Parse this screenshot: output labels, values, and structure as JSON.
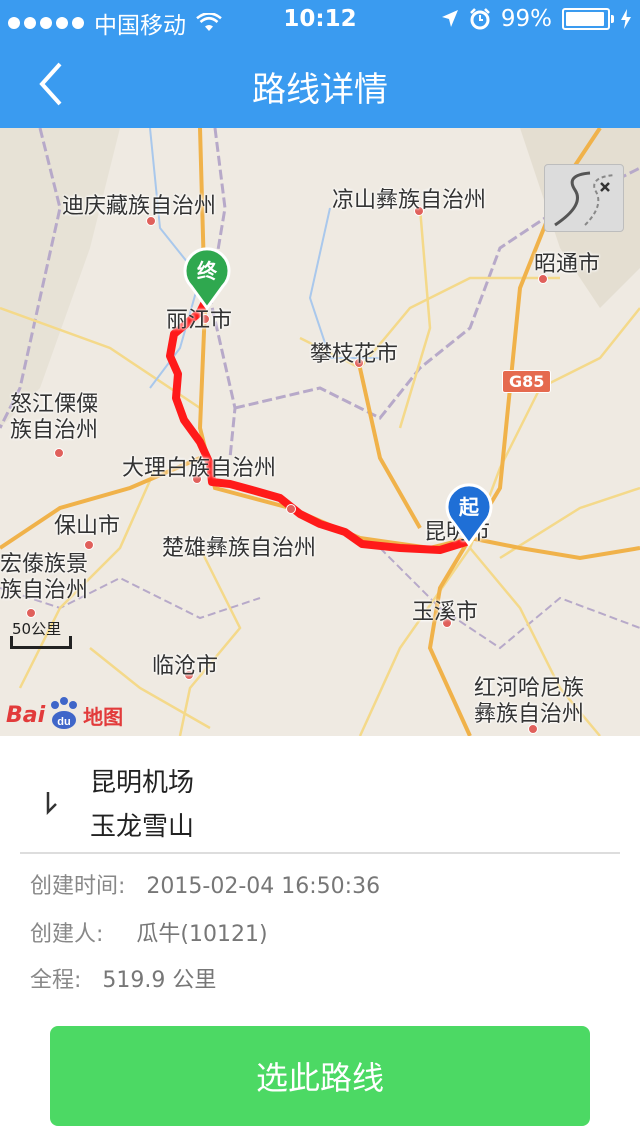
{
  "status": {
    "carrier": "中国移动",
    "time": "10:12",
    "battery": "99%",
    "battery_level": 0.99
  },
  "nav": {
    "title": "路线详情",
    "back_icon": "chevron-left-icon"
  },
  "map": {
    "labels": {
      "diqing": "迪庆藏族自治州",
      "liangshan": "凉山彝族自治州",
      "zhaotong": "昭通市",
      "lijiang": "丽江市",
      "panzhihua": "攀枝花市",
      "nujiang_1": "怒江傈僳",
      "nujiang_2": "族自治州",
      "dali": "大理白族自治州",
      "baoshan": "保山市",
      "chuxiong": "楚雄彝族自治州",
      "kunming": "昆明市",
      "dehong_1": "宏傣族景",
      "dehong_2": "族自治州",
      "yuxi": "玉溪市",
      "lincang": "临沧市",
      "honghe_1": "红河哈尼族",
      "honghe_2": "彝族自治州"
    },
    "highway": "G85",
    "start_marker": "起",
    "end_marker": "终",
    "scale": "50公里",
    "logo_text": "Bai",
    "logo_paw_text": "du",
    "logo_map": "地图",
    "route_color": "#ff1a1a",
    "start_color": "#1f6fd6",
    "end_color": "#2fa84f"
  },
  "route": {
    "from": "昆明机场",
    "to": "玉龙雪山",
    "created_time_label": "创建时间:",
    "created_time": "2015-02-04 16:50:36",
    "creator_label": "创建人:",
    "creator": "瓜牛(10121)",
    "distance_label": "全程:",
    "distance": "519.9 公里"
  },
  "actions": {
    "select_label": "选此路线",
    "select_color": "#4cd964"
  }
}
